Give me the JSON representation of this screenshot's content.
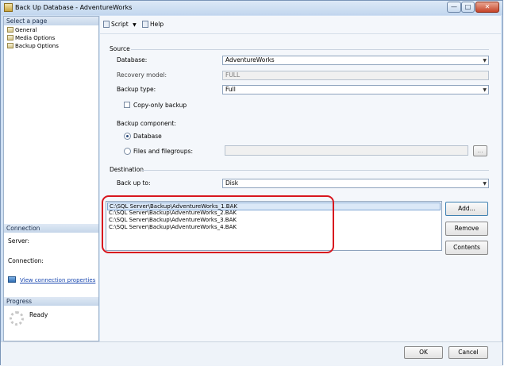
{
  "window": {
    "title": "Back Up Database - AdventureWorks",
    "minimize_label": "—",
    "maximize_label": "□",
    "close_label": "✕"
  },
  "left_panel": {
    "select_page_header": "Select a page",
    "pages": [
      {
        "label": "General"
      },
      {
        "label": "Media Options"
      },
      {
        "label": "Backup Options"
      }
    ],
    "connection_header": "Connection",
    "server_label": "Server:",
    "connection_label": "Connection:",
    "view_connection_link": "View connection properties",
    "progress_header": "Progress",
    "progress_status": "Ready"
  },
  "toolbar": {
    "script_label": "Script",
    "help_label": "Help"
  },
  "source": {
    "section_label": "Source",
    "database_label": "Database:",
    "database_value": "AdventureWorks",
    "recovery_model_label": "Recovery model:",
    "recovery_model_value": "FULL",
    "backup_type_label": "Backup type:",
    "backup_type_value": "Full",
    "copy_only_label": "Copy-only backup",
    "backup_component_label": "Backup component:",
    "component_database_label": "Database",
    "component_files_label": "Files and filegroups:",
    "browse_button_label": "..."
  },
  "destination": {
    "section_label": "Destination",
    "back_up_to_label": "Back up to:",
    "back_up_to_value": "Disk",
    "files": [
      "C:\\SQL Server\\Backup\\AdventureWorks_1.BAK",
      "C:\\SQL Server\\Backup\\AdventureWorks_2.BAK",
      "C:\\SQL Server\\Backup\\AdventureWorks_3.BAK",
      "C:\\SQL Server\\Backup\\AdventureWorks_4.BAK"
    ],
    "add_button": "Add...",
    "remove_button": "Remove",
    "contents_button": "Contents"
  },
  "footer": {
    "ok_button": "OK",
    "cancel_button": "Cancel"
  },
  "colors": {
    "highlight_ring": "#d8161e",
    "link": "#1a48b0",
    "window_frame": "#cfe0f3"
  }
}
